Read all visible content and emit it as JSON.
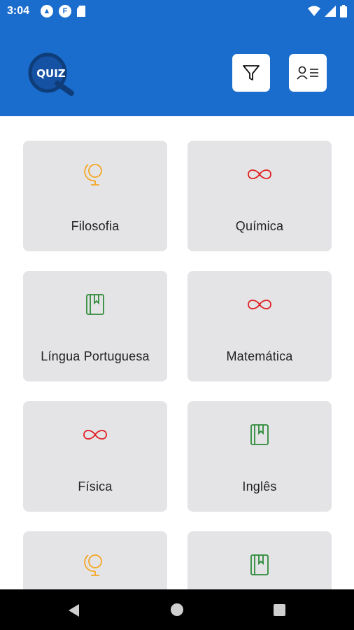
{
  "status_bar": {
    "time": "3:04",
    "icons_left": [
      "a-icon",
      "f-icon",
      "sd-card-icon"
    ],
    "icons_right": [
      "wifi-icon",
      "signal-icon",
      "battery-icon"
    ]
  },
  "header": {
    "logo_text": "QUIZ",
    "filter_button": "filter-icon",
    "profile_button": "profile-list-icon",
    "background": "#1a6dcc"
  },
  "categories": [
    {
      "label": "Filosofia",
      "icon": "globe-icon",
      "color": "#f5a623"
    },
    {
      "label": "Química",
      "icon": "infinity-icon",
      "color": "#e02020"
    },
    {
      "label": "Língua Portuguesa",
      "icon": "book-icon",
      "color": "#2e8b3a"
    },
    {
      "label": "Matemática",
      "icon": "infinity-icon",
      "color": "#e02020"
    },
    {
      "label": "Física",
      "icon": "infinity-icon",
      "color": "#e02020"
    },
    {
      "label": "Inglês",
      "icon": "book-icon",
      "color": "#2e8b3a"
    },
    {
      "label": "",
      "icon": "globe-icon",
      "color": "#f5a623"
    },
    {
      "label": "",
      "icon": "book-icon",
      "color": "#2e8b3a"
    }
  ],
  "nav_bar": {
    "buttons": [
      "back-icon",
      "home-icon",
      "recents-icon"
    ]
  }
}
